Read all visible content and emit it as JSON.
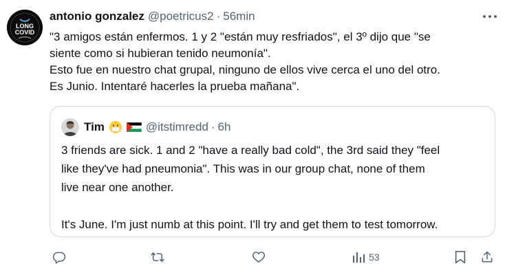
{
  "tweet": {
    "author_name": "antonio gonzalez",
    "handle": "@poetricus2",
    "separator": "·",
    "time": "56min",
    "avatar_text_top": "LONG",
    "avatar_text_bottom": "COVID",
    "body_lines": [
      "\"3 amigos están enfermos. 1 y 2 \"están muy resfriados\", el 3º dijo que \"se",
      "siente como si hubieran tenido neumonía\".",
      "Esto fue en nuestro chat grupal, ninguno de ellos vive cerca el uno del otro.",
      "Es Junio. Intentaré hacerles la prueba mañana\"."
    ]
  },
  "quote": {
    "author_name": "Tim",
    "handle": "@itstimredd",
    "separator": "·",
    "time": "6h",
    "emoji_icons": [
      "mask-face-icon",
      "palestine-flag-icon"
    ],
    "body_lines": [
      "3 friends are sick. 1 and 2 \"have a really bad cold\", the 3rd said they \"feel",
      "like they've had pneumonia\". This was in our group chat, none of them",
      "live near one another.",
      "",
      "It's June. I'm just numb at this point. I'll try and get them to test tomorrow."
    ]
  },
  "actions": {
    "reply_icon": "reply-icon",
    "retweet_icon": "retweet-icon",
    "like_icon": "heart-icon",
    "views_icon": "views-icon",
    "views_count": "53",
    "bookmark_icon": "bookmark-icon",
    "share_icon": "share-icon"
  },
  "colors": {
    "text": "#0f1419",
    "secondary": "#536471",
    "border": "#cfd9de"
  }
}
